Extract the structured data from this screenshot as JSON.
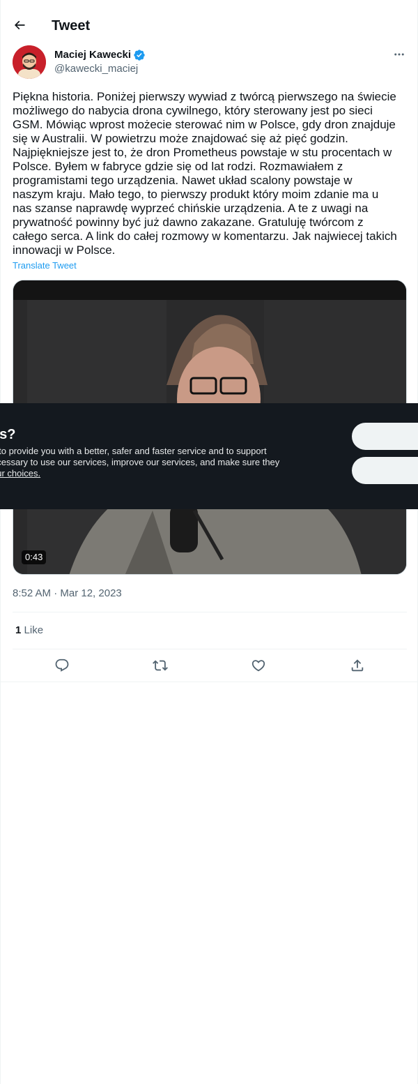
{
  "header": {
    "title": "Tweet"
  },
  "author": {
    "name": "Maciej Kawecki",
    "handle": "@kawecki_maciej"
  },
  "tweet": {
    "text": "Piękna historia. Poniżej pierwszy wywiad z twórcą pierwszego na świecie\nmożliwego do nabycia drona cywilnego, który sterowany jest po sieci\nGSM. Mówiąc wprost możecie sterować nim w Polsce, gdy dron znajduje\nsię w Australii. W powietrzu może znajdować się aż pięć godzin.\nNajpiękniejsze jest to, że dron Prometheus powstaje w stu procentach w\nPolsce. Byłem w fabryce gdzie się od lat rodzi. Rozmawiałem z\nprogramistami tego urządzenia. Nawet układ scalony powstaje w\nnaszym kraju. Mało tego, to pierwszy produkt który moim zdanie ma u\nnas szanse naprawdę wyprzeć chińskie urządzenia. A te z uwagi na\nprywatność powinny być już dawno zakazane. Gratuluję twórcom z\ncałego serca. A link do całej rozmowy w komentarzu. Jak najwiecej takich\ninnowacji w Polsce.",
    "translate_label": "Translate Tweet",
    "video_duration": "0:43",
    "timestamp": "8:52 AM · Mar 12, 2023",
    "like_count": "1",
    "like_label": "Like"
  },
  "cookie_banner": {
    "title": "es?",
    "text_line1": "s to provide you with a better, safer and faster service and to support",
    "text_line2": "ecessary to use our services, improve our services, and make sure they",
    "link_text": "our choices."
  },
  "colors": {
    "accent": "#1d9bf0",
    "text": "#0f1419",
    "secondary": "#536471",
    "banner_bg": "#14191f"
  },
  "icons": [
    "back-arrow-icon",
    "verified-badge-icon",
    "more-icon",
    "reply-icon",
    "retweet-icon",
    "like-icon",
    "share-icon"
  ]
}
